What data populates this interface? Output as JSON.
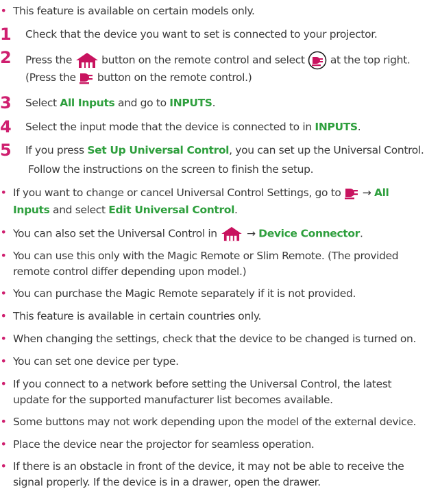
{
  "colors": {
    "accent_number": "#cf1f6f",
    "highlight": "#2e9f3d",
    "text": "#3a3a3a",
    "icon": "#c8135f"
  },
  "icons": {
    "home": "home-icon",
    "input": "input-icon",
    "arrow": "right-arrow"
  },
  "arrow": "→",
  "intro": "This feature is available on certain models only.",
  "steps": [
    {
      "num": "1",
      "text": "Check that the device you want to set is connected to your projector."
    },
    {
      "num": "2",
      "a": "Press the",
      "b": "button on the remote control and select",
      "c": "at the top right.",
      "d": "(Press the",
      "e": "button on the remote control.)"
    },
    {
      "num": "3",
      "a": "Select",
      "b1": "All Inputs",
      "c": "and go to",
      "b2": "INPUTS",
      "d": "."
    },
    {
      "num": "4",
      "a": "Select the input mode that the device is connected to in",
      "b": "INPUTS",
      "c": "."
    },
    {
      "num": "5",
      "line1a": "If you press",
      "line1b": "Set Up Universal Control",
      "line1c": ", you can set up the Universal Control.",
      "line2": "Follow the instructions on the screen to finish the setup."
    }
  ],
  "notes": {
    "change": {
      "a": "If you want to change or cancel Universal Control Settings, go to",
      "b": "All",
      "c": "Inputs",
      "d": "and select",
      "e": "Edit Universal Control",
      "f": "."
    },
    "connector": {
      "a": "You can also set the Universal Control in",
      "b": "Device Connector",
      "c": "."
    },
    "magic": {
      "line1": "You can use this only with the Magic Remote or Slim Remote. (The provided",
      "line2": "remote control differ depending upon model.)"
    },
    "purchase": "You can purchase the Magic Remote separately if it is not provided.",
    "countries": "This feature is available in certain countries only.",
    "changing": "When changing the settings, check that the device to be changed is turned on.",
    "per_type": "You can set one device per type.",
    "network": {
      "line1": "If you connect to a network before setting the Universal Control, the latest",
      "line2": "update for the supported manufacturer list becomes available."
    },
    "buttons": "Some buttons may not work depending upon the model of the external device.",
    "place": "Place the device near the projector for seamless operation.",
    "obstacle": {
      "line1": "If there is an obstacle in front of the device, it may not be able to receive the",
      "line2": "signal properly. If the device is in a drawer, open the drawer."
    }
  }
}
